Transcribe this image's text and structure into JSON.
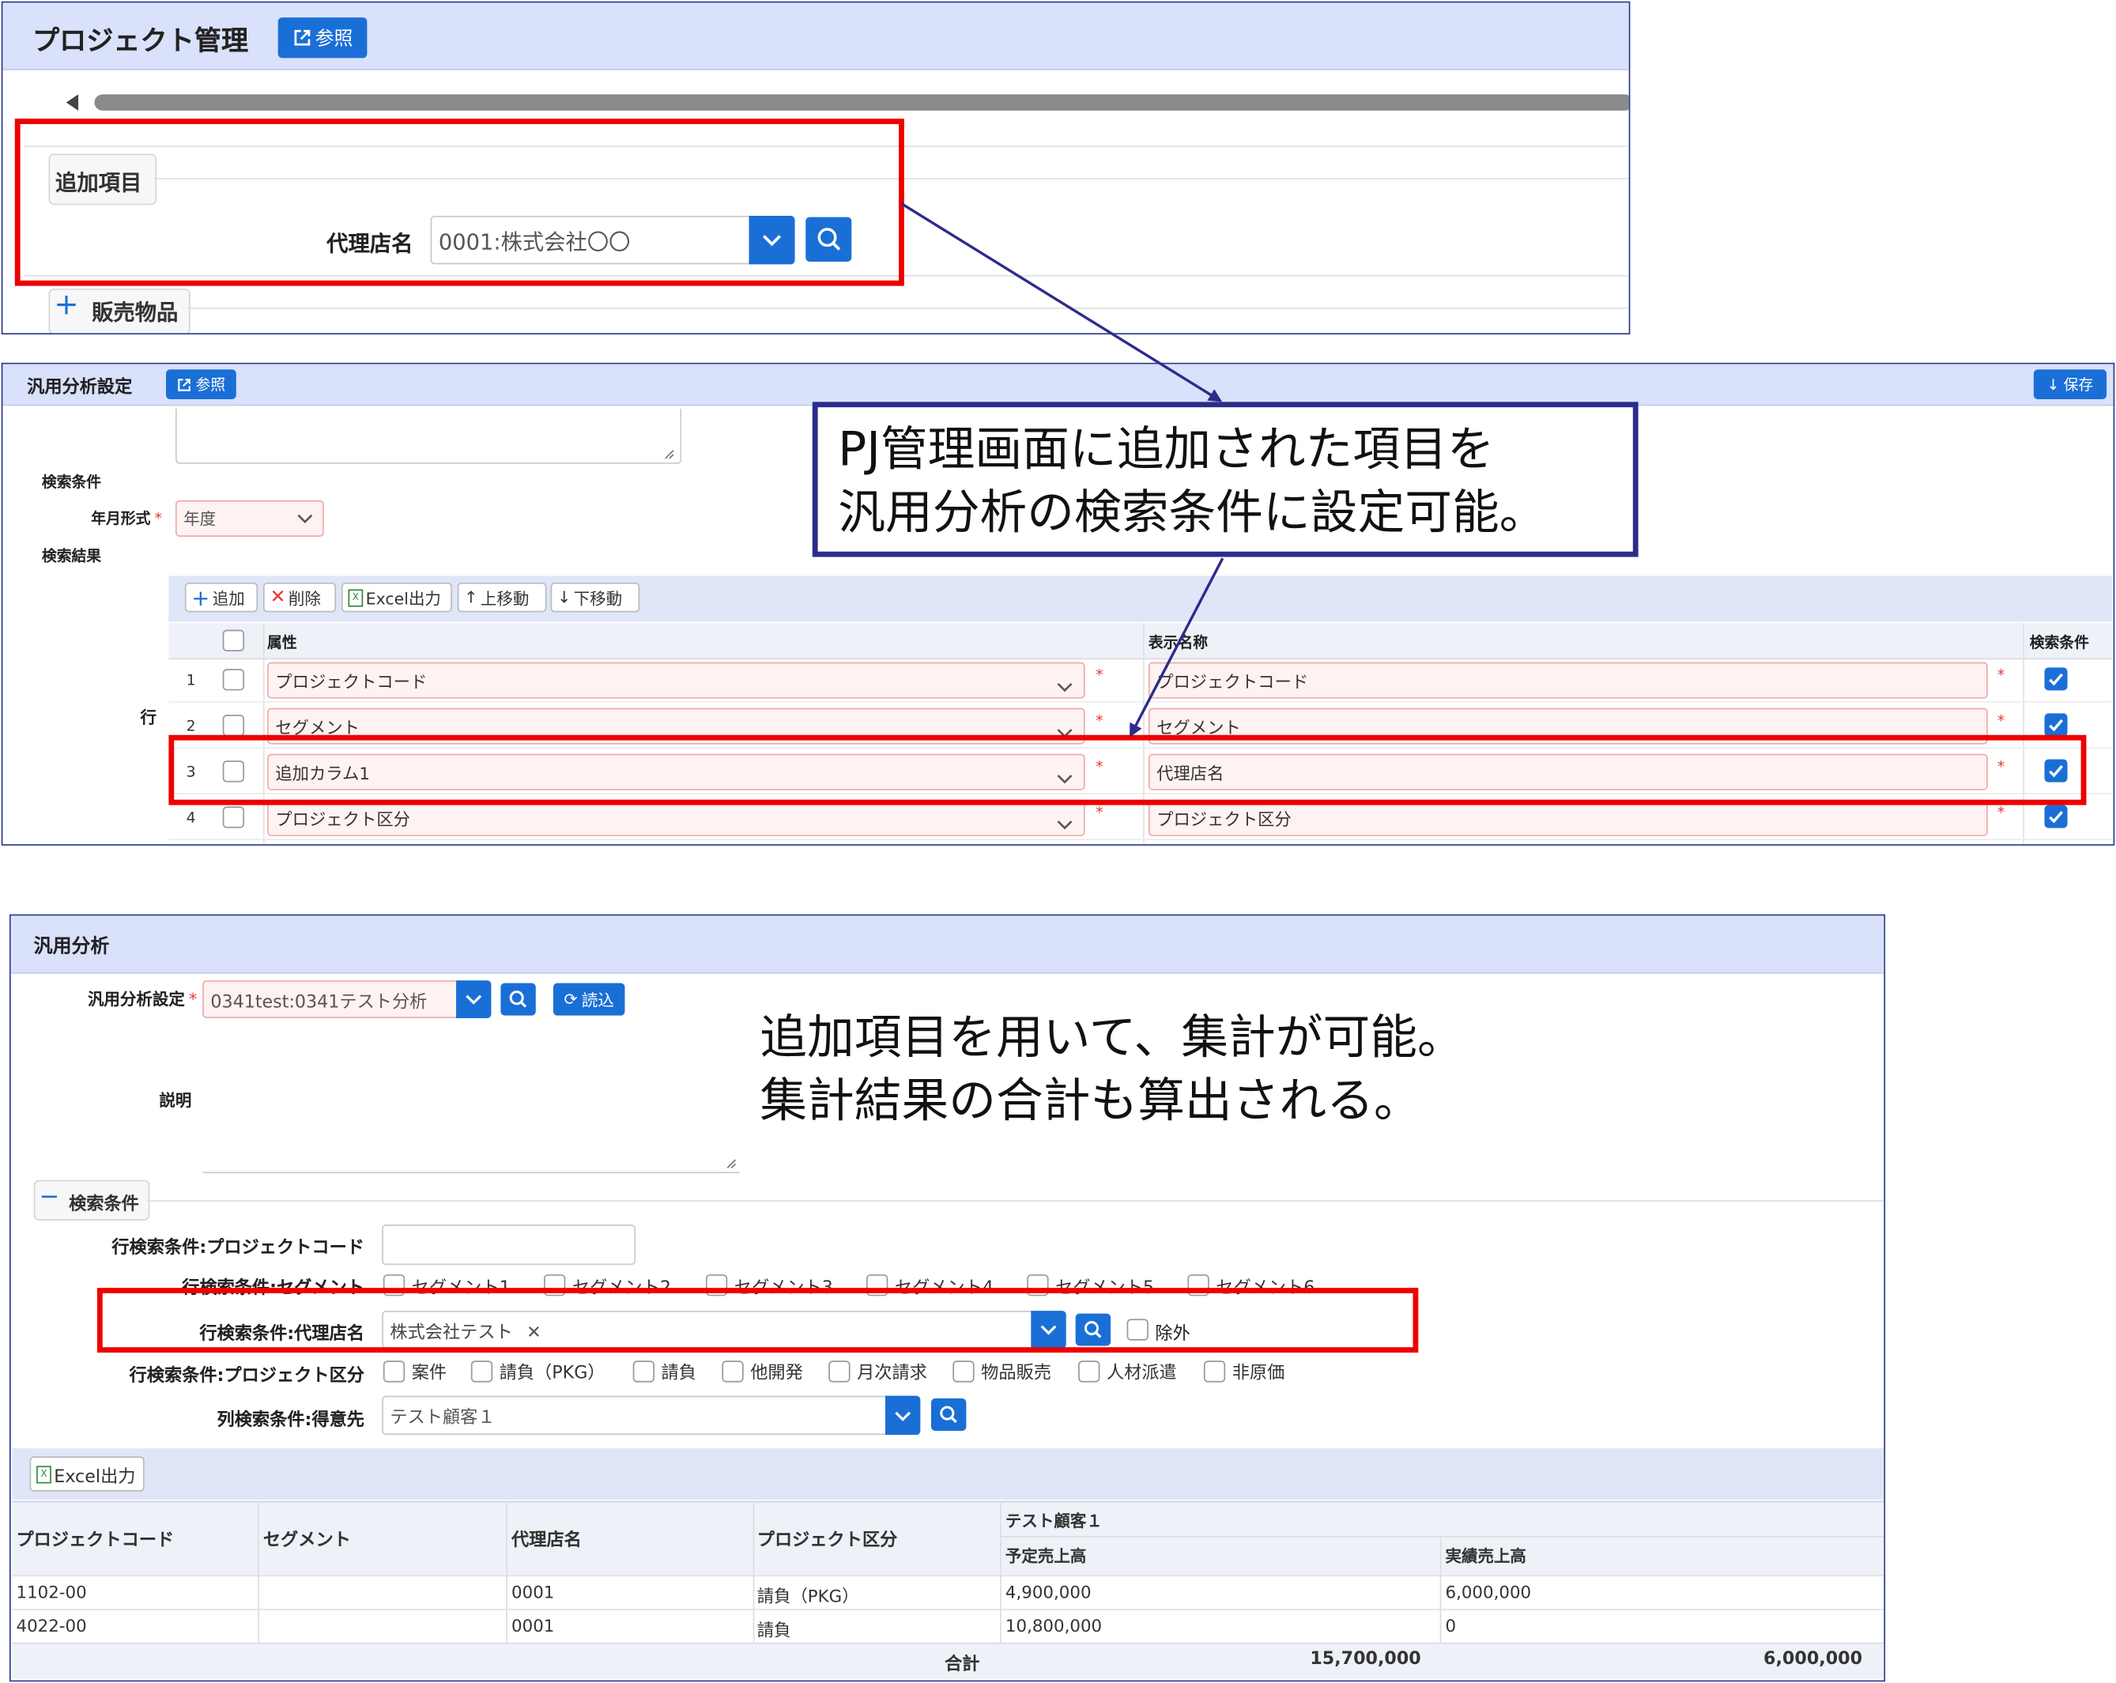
{
  "pm": {
    "title": "プロジェクト管理",
    "ref_label": "参照",
    "section_added": "追加項目",
    "agent_label": "代理店名",
    "agent_value": "0001:株式会社〇〇",
    "section_sales": "販売物品"
  },
  "setting": {
    "title": "汎用分析設定",
    "ref_label": "参照",
    "save_label": "保存",
    "search_cond": "検索条件",
    "ym_label": "年月形式",
    "ym_value": "年度",
    "search_result": "検索結果",
    "row_label": "行",
    "toolbar": {
      "add": "追加",
      "delete": "削除",
      "excel": "Excel出力",
      "up": "上移動",
      "down": "下移動"
    },
    "columns": {
      "attr": "属性",
      "display": "表示名称",
      "cond": "検索条件"
    },
    "rows": [
      {
        "no": "1",
        "attr": "プロジェクトコード",
        "display": "プロジェクトコード",
        "cond": true
      },
      {
        "no": "2",
        "attr": "セグメント",
        "display": "セグメント",
        "cond": true
      },
      {
        "no": "3",
        "attr": "追加カラム1",
        "display": "代理店名",
        "cond": true
      },
      {
        "no": "4",
        "attr": "プロジェクト区分",
        "display": "プロジェクト区分",
        "cond": true
      }
    ]
  },
  "callouts": {
    "box1_line1": "PJ管理画面に追加された項目を",
    "box1_line2": "汎用分析の検索条件に設定可能。",
    "note_line1": "追加項目を用いて、集計が可能。",
    "note_line2": "集計結果の合計も算出される。"
  },
  "analysis": {
    "title": "汎用分析",
    "setting_label": "汎用分析設定",
    "setting_value": "0341test:0341テスト分析",
    "load_label": "読込",
    "desc_label": "説明",
    "search_cond": "検索条件",
    "f_code": "行検索条件:プロジェクトコード",
    "f_segment": "行検索条件:セグメント",
    "segments": [
      "セグメント1",
      "セグメント2",
      "セグメント3",
      "セグメント4",
      "セグメント5",
      "セグメント6"
    ],
    "f_agent": "行検索条件:代理店名",
    "agent_tag": "株式会社テスト",
    "exclude_label": "除外",
    "f_kubun": "行検索条件:プロジェクト区分",
    "kubun_options": [
      "案件",
      "請負（PKG）",
      "請負",
      "他開発",
      "月次請求",
      "物品販売",
      "人材派遣",
      "非原価"
    ],
    "f_customer": "列検索条件:得意先",
    "customer_value": "テスト顧客１",
    "excel_label": "Excel出力",
    "table": {
      "h_code": "プロジェクトコード",
      "h_segment": "セグメント",
      "h_agent": "代理店名",
      "h_kubun": "プロジェクト区分",
      "h_customer": "テスト顧客１",
      "h_planned": "予定売上高",
      "h_actual": "実績売上高",
      "rows": [
        {
          "code": "1102-00",
          "segment": "",
          "agent": "0001",
          "kubun": "請負（PKG）",
          "planned": "4,900,000",
          "actual": "6,000,000"
        },
        {
          "code": "4022-00",
          "segment": "",
          "agent": "0001",
          "kubun": "請負",
          "planned": "10,800,000",
          "actual": "0"
        }
      ],
      "total_label": "合計",
      "total_planned": "15,700,000",
      "total_actual": "6,000,000"
    }
  }
}
